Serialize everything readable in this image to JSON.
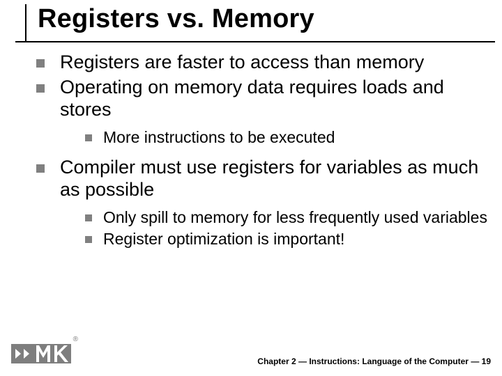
{
  "title": "Registers vs. Memory",
  "bullets": {
    "a": "Registers are faster to access than memory",
    "b": "Operating on memory data requires loads and stores",
    "b_sub": {
      "a": "More instructions to be executed"
    },
    "c": "Compiler must use registers for variables as much as possible",
    "c_sub": {
      "a": "Only spill to memory for less frequently used variables",
      "b": "Register optimization is important!"
    }
  },
  "footer": {
    "chapter": "Chapter 2 — Instructions: Language of the Computer — 19",
    "trademark": "®"
  }
}
